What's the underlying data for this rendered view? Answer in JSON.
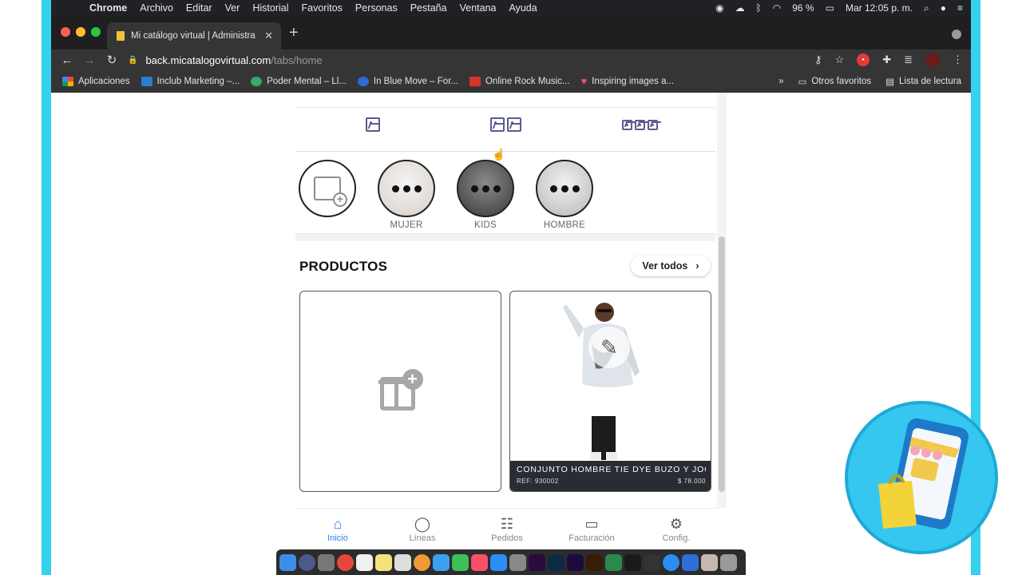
{
  "menubar": {
    "items": [
      "Chrome",
      "Archivo",
      "Editar",
      "Ver",
      "Historial",
      "Favoritos",
      "Personas",
      "Pestaña",
      "Ventana",
      "Ayuda"
    ],
    "battery": "96 %",
    "clock": "Mar 12:05 p. m."
  },
  "browser": {
    "tab_title": "Mi catálogo virtual | Administra",
    "url_host": "back.micatalogovirtual.com",
    "url_path": "/tabs/home",
    "bookmarks": [
      {
        "label": "Aplicaciones",
        "color": "#e94b3c"
      },
      {
        "label": "Inclub Marketing –...",
        "color": "#2b7cd3"
      },
      {
        "label": "Poder Mental – Ll...",
        "color": "#3aa76d"
      },
      {
        "label": "In Blue Move – For...",
        "color": "#2a6bd6"
      },
      {
        "label": "Online Rock Music...",
        "color": "#d6342a"
      },
      {
        "label": "Inspiring images a...",
        "color": "#e94b8a"
      }
    ],
    "more": "»",
    "other_favorites": "Otros favoritos",
    "reading_list": "Lista de lectura"
  },
  "categories": [
    {
      "label": "MUJER"
    },
    {
      "label": "KIDS"
    },
    {
      "label": "HOMBRE"
    }
  ],
  "products": {
    "title": "PRODUCTOS",
    "see_all": "Ver todos",
    "item": {
      "name": "CONJUNTO HOMBRE TIE DYE BUZO Y JOG",
      "ref": "REF: 930002",
      "price": "$ 78.000"
    }
  },
  "bottom_nav": [
    {
      "label": "Inicio",
      "icon": "home-icon",
      "active": true
    },
    {
      "label": "Líneas",
      "icon": "whatsapp-icon",
      "active": false
    },
    {
      "label": "Pedidos",
      "icon": "orders-icon",
      "active": false
    },
    {
      "label": "Facturación",
      "icon": "card-icon",
      "active": false
    },
    {
      "label": "Config.",
      "icon": "gear-icon",
      "active": false
    }
  ],
  "colors": {
    "accent": "#2f7fe0",
    "frame": "#35d1ee",
    "view_icon": "#5b5a8f"
  }
}
